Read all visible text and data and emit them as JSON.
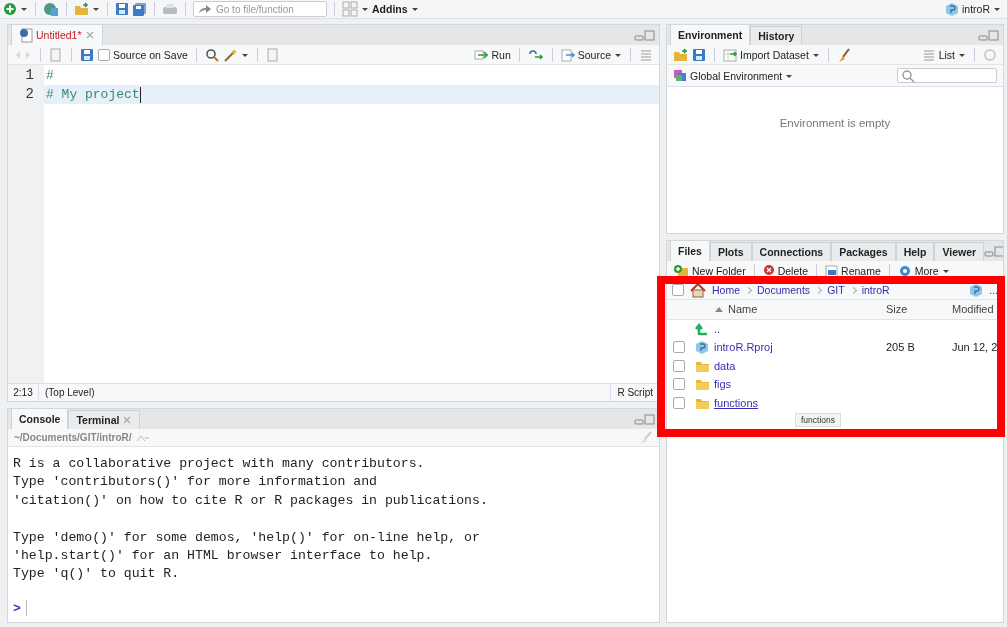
{
  "toolbar": {
    "goto_placeholder": "Go to file/function",
    "addins": "Addins",
    "project": "introR"
  },
  "editor": {
    "tabs": [
      {
        "label": "Untitled1*",
        "modified": true,
        "selected": true
      }
    ],
    "source_on_save": {
      "label": "Source on Save",
      "checked": false
    },
    "run": "Run",
    "source": "Source",
    "lines": [
      {
        "number": "1",
        "text": "#",
        "current": false
      },
      {
        "number": "2",
        "text": "# My project",
        "current": true
      }
    ],
    "status": {
      "position": "2:13",
      "scope": "(Top Level)",
      "filetype": "R Script"
    }
  },
  "console": {
    "tabs": [
      {
        "label": "Console",
        "selected": true
      },
      {
        "label": "Terminal",
        "selected": false
      }
    ],
    "path": "~/Documents/GIT/introR/",
    "output": [
      [
        "R is a collaborative project with many contributors.",
        "Type 'contributors()' for more information and",
        "'citation()' on how to cite R or R packages in publications."
      ],
      [
        "Type 'demo()' for some demos, 'help()' for on-line help, or",
        "'help.start()' for an HTML browser interface to help.",
        "Type 'q()' to quit R."
      ]
    ],
    "prompt": ">"
  },
  "environment": {
    "tabs": [
      {
        "label": "Environment",
        "selected": true
      },
      {
        "label": "History",
        "selected": false
      }
    ],
    "import": "Import Dataset",
    "view": "List",
    "scope": "Global Environment",
    "empty": "Environment is empty"
  },
  "files": {
    "tabs": [
      {
        "label": "Files",
        "selected": true
      },
      {
        "label": "Plots",
        "selected": false
      },
      {
        "label": "Connections",
        "selected": false
      },
      {
        "label": "Packages",
        "selected": false
      },
      {
        "label": "Help",
        "selected": false
      },
      {
        "label": "Viewer",
        "selected": false
      }
    ],
    "actions": [
      "New Folder",
      "Delete",
      "Rename",
      "More"
    ],
    "select_all_checked": false,
    "breadcrumb": [
      "Home",
      "Documents",
      "GIT",
      "introR"
    ],
    "more": "...",
    "columns": [
      "Name",
      "Size",
      "Modified"
    ],
    "rows": [
      {
        "kind": "up",
        "name": ".."
      },
      {
        "kind": "project",
        "name": "introR.Rproj",
        "size": "205 B",
        "modified": "Jun 12, 2",
        "checked": false,
        "hovered": false
      },
      {
        "kind": "folder",
        "name": "data",
        "checked": false,
        "hovered": false
      },
      {
        "kind": "folder",
        "name": "figs",
        "checked": false,
        "hovered": false
      },
      {
        "kind": "folder",
        "name": "functions",
        "checked": false,
        "hovered": true
      }
    ],
    "tooltip": "functions"
  }
}
